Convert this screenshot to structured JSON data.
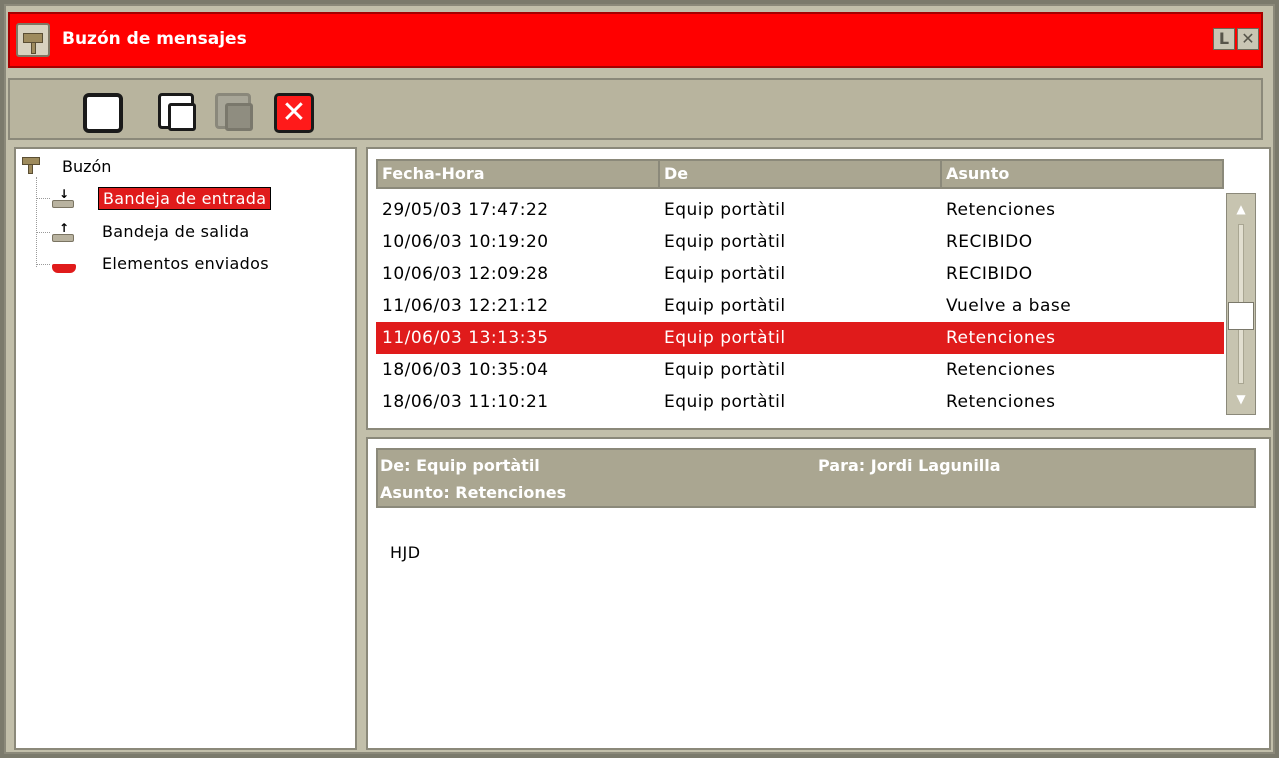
{
  "window": {
    "title": "Buzón de mensajes",
    "title_buttons": {
      "minimize_glyph": "L",
      "close_glyph": "✕"
    },
    "accent_color": "#ff0000",
    "selection_color": "#e01b1b"
  },
  "toolbar": {
    "buttons": [
      {
        "name": "new-message",
        "icon": "new-message-icon"
      },
      {
        "name": "reply",
        "icon": "reply-icon"
      },
      {
        "name": "forward",
        "icon": "forward-icon",
        "disabled": true
      },
      {
        "name": "delete",
        "icon": "delete-icon",
        "glyph": "✕"
      }
    ]
  },
  "tree": {
    "root": {
      "label": "Buzón",
      "icon": "mailbox-icon"
    },
    "items": [
      {
        "label": "Bandeja de entrada",
        "icon": "inbox-icon",
        "arrow": "↓",
        "selected": true
      },
      {
        "label": "Bandeja de salida",
        "icon": "outbox-icon",
        "arrow": "↑",
        "selected": false
      },
      {
        "label": "Elementos enviados",
        "icon": "sent-items-icon",
        "selected": false
      }
    ]
  },
  "message_list": {
    "columns": [
      "Fecha-Hora",
      "De",
      "Asunto"
    ],
    "rows": [
      {
        "datetime": "29/05/03 17:47:22",
        "from": "Equip portàtil",
        "subject": "Retenciones",
        "selected": false
      },
      {
        "datetime": "10/06/03 10:19:20",
        "from": "Equip portàtil",
        "subject": "RECIBIDO",
        "selected": false
      },
      {
        "datetime": "10/06/03 12:09:28",
        "from": "Equip portàtil",
        "subject": "RECIBIDO",
        "selected": false
      },
      {
        "datetime": "11/06/03 12:21:12",
        "from": "Equip portàtil",
        "subject": "Vuelve a base",
        "selected": false
      },
      {
        "datetime": "11/06/03 13:13:35",
        "from": "Equip portàtil",
        "subject": "Retenciones",
        "selected": true
      },
      {
        "datetime": "18/06/03 10:35:04",
        "from": "Equip portàtil",
        "subject": "Retenciones",
        "selected": false
      },
      {
        "datetime": "18/06/03 11:10:21",
        "from": "Equip portàtil",
        "subject": "Retenciones",
        "selected": false
      }
    ],
    "scrollbar": {
      "up_glyph": "▲",
      "down_glyph": "▼"
    }
  },
  "preview": {
    "from": "De: Equip portàtil",
    "to": "Para: Jordi Lagunilla",
    "subject": "Asunto: Retenciones",
    "body": "HJD"
  }
}
